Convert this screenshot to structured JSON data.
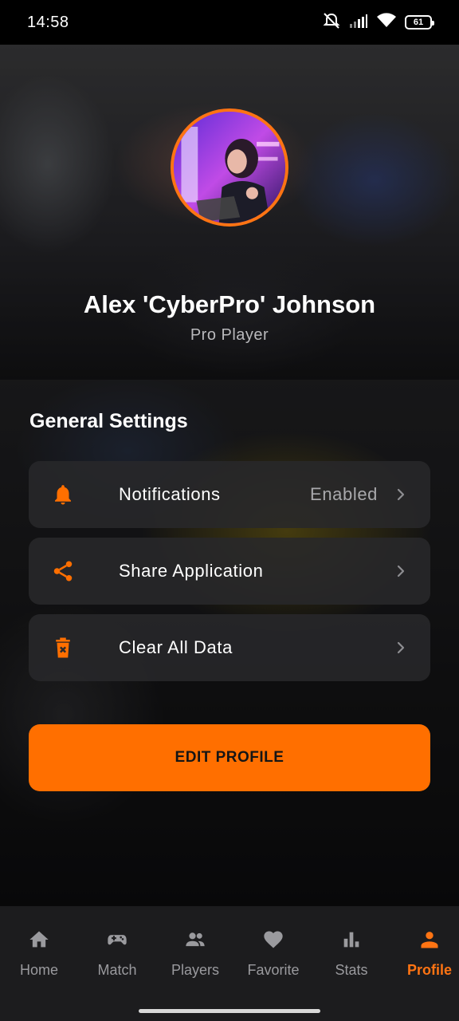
{
  "status_bar": {
    "time": "14:58",
    "battery": "61",
    "icons": [
      "mute-icon",
      "signal-icon",
      "wifi-icon",
      "battery-icon"
    ]
  },
  "profile": {
    "name": "Alex 'CyberPro' Johnson",
    "role": "Pro Player",
    "avatar_border_color": "#ff7413"
  },
  "settings": {
    "section_title": "General Settings",
    "items": [
      {
        "label": "Notifications",
        "value": "Enabled",
        "icon": "bell-icon"
      },
      {
        "label": "Share Application",
        "value": "",
        "icon": "share-icon"
      },
      {
        "label": "Clear All Data",
        "value": "",
        "icon": "trash-icon"
      }
    ]
  },
  "actions": {
    "edit_profile": "EDIT PROFILE"
  },
  "bottom_nav": {
    "items": [
      {
        "label": "Home",
        "icon": "home-icon",
        "active": false
      },
      {
        "label": "Match",
        "icon": "gamepad-icon",
        "active": false
      },
      {
        "label": "Players",
        "icon": "players-icon",
        "active": false
      },
      {
        "label": "Favorite",
        "icon": "heart-icon",
        "active": false
      },
      {
        "label": "Stats",
        "icon": "bar-chart-icon",
        "active": false
      },
      {
        "label": "Profile",
        "icon": "person-icon",
        "active": true
      }
    ]
  },
  "colors": {
    "accent": "#ff6f00",
    "inactive_nav": "#9a9a9e"
  }
}
